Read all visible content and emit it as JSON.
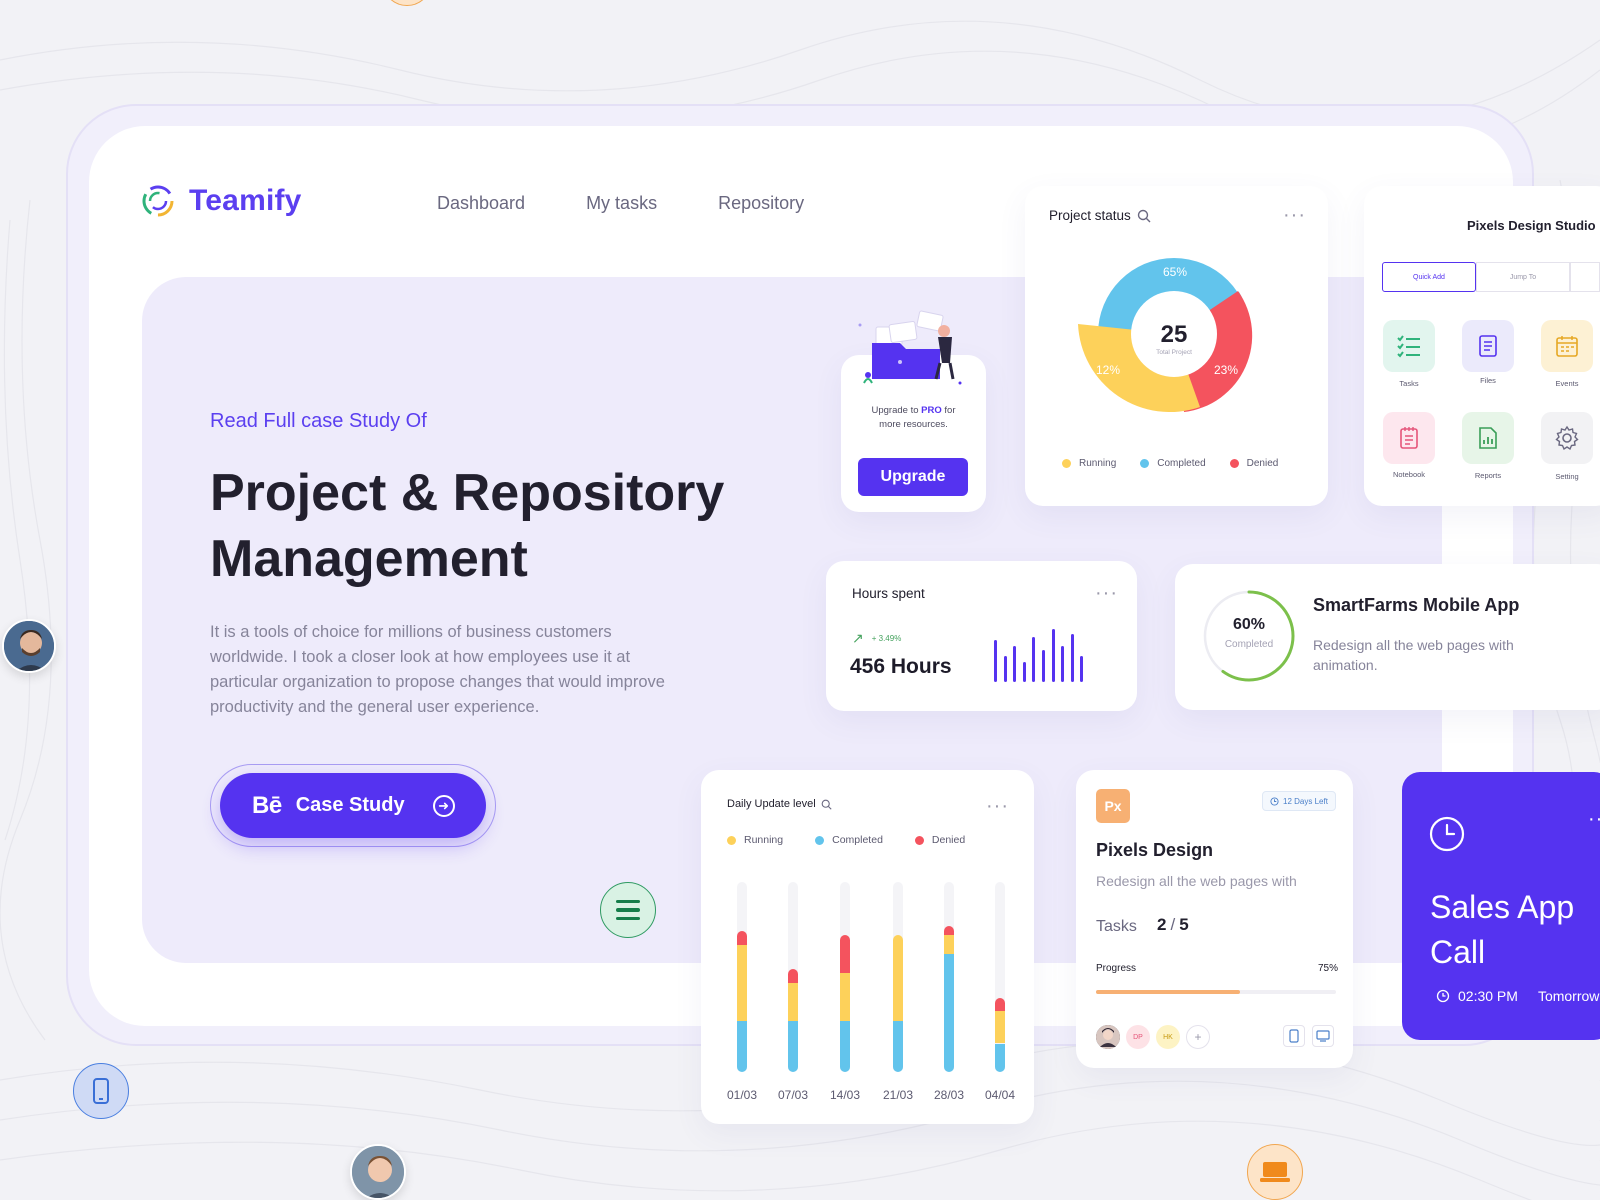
{
  "brand": {
    "name": "Teamify",
    "color": "#5b3ff0"
  },
  "nav": [
    "Dashboard",
    "My tasks",
    "Repository"
  ],
  "hero": {
    "eyebrow": "Read Full case Study Of",
    "headline_line1": "Project & Repository",
    "headline_line2": "Management",
    "description": "It is a tools of choice for millions of business customers worldwide. I took a closer look at how employees use it at particular organization to propose changes that would improve productivity and the general user experience.",
    "cta_icon": "Bē",
    "cta_label": "Case Study"
  },
  "upgrade": {
    "text_prefix": "Upgrade to",
    "text_highlight": "PRO",
    "text_suffix": "for",
    "text_line2": "more resources.",
    "button": "Upgrade"
  },
  "project_status": {
    "title": "Project status",
    "total": "25",
    "total_label": "Total Project",
    "legend": [
      {
        "label": "Running",
        "color": "#fdd15a"
      },
      {
        "label": "Completed",
        "color": "#62c4ec"
      },
      {
        "label": "Denied",
        "color": "#f4535e"
      }
    ]
  },
  "studio": {
    "title": "Pixels Design Studio",
    "tabs": [
      "Quick Add",
      "Jump To"
    ],
    "tiles": [
      {
        "label": "Tasks",
        "icon": "checklist-icon",
        "bg": "#e2f5ee"
      },
      {
        "label": "Files",
        "icon": "file-icon",
        "bg": "#ebeafb"
      },
      {
        "label": "Events",
        "icon": "calendar-icon",
        "bg": "#fdf1d4"
      },
      {
        "label": "Notebook",
        "icon": "notebook-icon",
        "bg": "#fde7ee"
      },
      {
        "label": "Reports",
        "icon": "report-icon",
        "bg": "#e7f5e8"
      },
      {
        "label": "Setting",
        "icon": "gear-icon",
        "bg": "#f2f2f4"
      }
    ]
  },
  "hours": {
    "title": "Hours spent",
    "trend": "+ 3.49%",
    "value": "456 Hours",
    "bar_levels": [
      0.72,
      0.45,
      0.62,
      0.35,
      0.78,
      0.55,
      0.92,
      0.62,
      0.82,
      0.45
    ]
  },
  "smartfarms": {
    "title": "SmartFarms Mobile App",
    "description": "Redesign all the web pages with animation.",
    "percent": "60%",
    "percent_label": "Completed",
    "progress": 0.6
  },
  "daily": {
    "title": "Daily Update level",
    "legend": [
      {
        "label": "Running",
        "color": "#fdd15a"
      },
      {
        "label": "Completed",
        "color": "#62c4ec"
      },
      {
        "label": "Denied",
        "color": "#f4535e"
      }
    ]
  },
  "chart_data": {
    "type": "bar",
    "title": "Daily Update level",
    "categories": [
      "01/03",
      "07/03",
      "14/03",
      "21/03",
      "28/03",
      "04/04"
    ],
    "series": [
      {
        "name": "Completed",
        "values": [
          27,
          27,
          27,
          27,
          62,
          15
        ]
      },
      {
        "name": "Running",
        "values": [
          40,
          20,
          25,
          45,
          10,
          17
        ]
      },
      {
        "name": "Denied",
        "values": [
          7,
          7,
          20,
          0,
          5,
          7
        ]
      }
    ],
    "ylim": [
      0,
      100
    ],
    "stacked": true
  },
  "pixels": {
    "badge": "Px",
    "days_left": "12 Days Left",
    "title": "Pixels Design",
    "description": "Redesign all the web pages with",
    "tasks_label": "Tasks",
    "tasks_done": "2",
    "tasks_total": "5",
    "progress_label": "Progress",
    "progress_value": "75%",
    "progress": 0.6,
    "avatars": [
      "DP",
      "HK",
      "+"
    ]
  },
  "sales": {
    "title_line1": "Sales App",
    "title_line2": "Call",
    "time": "02:30 PM",
    "day": "Tomorrow"
  }
}
